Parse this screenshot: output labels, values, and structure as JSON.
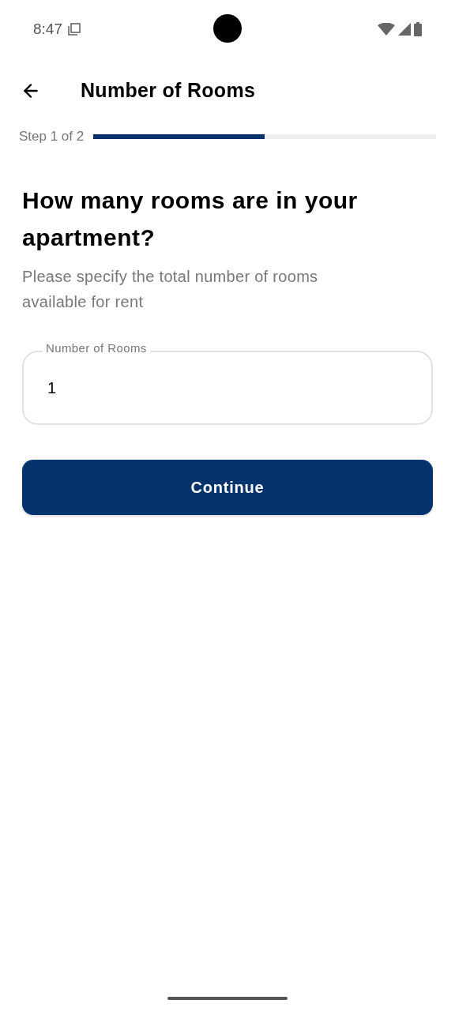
{
  "status_bar": {
    "time": "8:47"
  },
  "header": {
    "title": "Number of Rooms"
  },
  "progress": {
    "label": "Step 1 of 2",
    "level": 0.5
  },
  "question": {
    "heading": "How many rooms are in your apartment?",
    "subtitle": "Please specify the total number of rooms available for rent"
  },
  "field": {
    "label": "Number of Rooms",
    "value": "1"
  },
  "buttons": [
    "Continue"
  ]
}
